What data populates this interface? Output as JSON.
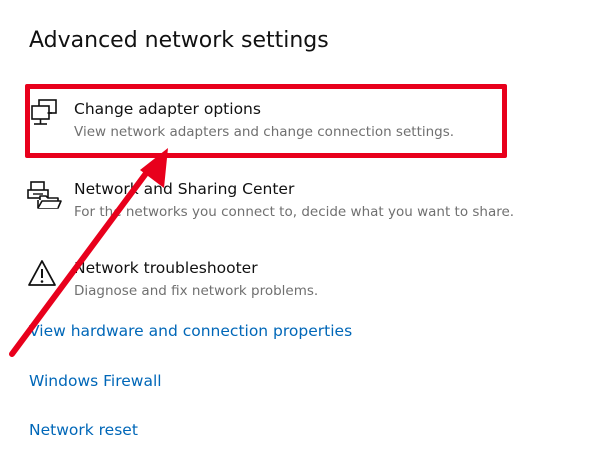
{
  "page": {
    "title": "Advanced network settings"
  },
  "settings": [
    {
      "label": "Change adapter options",
      "description": "View network adapters and change connection settings.",
      "icon": "network-adapter-icon"
    },
    {
      "label": "Network and Sharing Center",
      "description": "For the networks you connect to, decide what you want to share.",
      "icon": "network-sharing-center-icon"
    },
    {
      "label": "Network troubleshooter",
      "description": "Diagnose and fix network problems.",
      "icon": "warning-triangle-icon"
    }
  ],
  "links": [
    "View hardware and connection properties",
    "Windows Firewall",
    "Network reset"
  ],
  "colors": {
    "accent_link": "#0067b8",
    "annotation_red": "#e8001c",
    "description_gray": "#707070"
  }
}
